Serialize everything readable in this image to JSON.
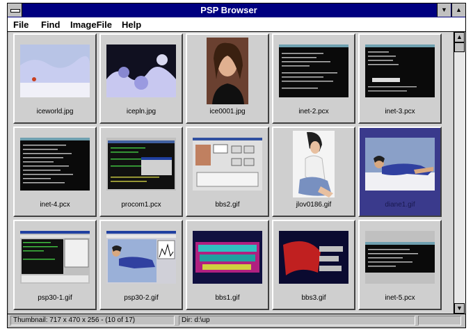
{
  "window": {
    "title": "PSP Browser"
  },
  "menu": [
    "File",
    "Find",
    "ImageFile",
    "Help"
  ],
  "thumbnails": [
    "iceworld.jpg",
    "icepln.jpg",
    "ice0001.jpg",
    "inet-2.pcx",
    "inet-3.pcx",
    "inet-4.pcx",
    "procom1.pcx",
    "bbs2.gif",
    "jlov0186.gif",
    "diane1.gif",
    "psp30-1.gif",
    "psp30-2.gif",
    "bbs1.gif",
    "bbs3.gif",
    "inet-5.pcx"
  ],
  "selected_thumbnail": "diane1.gif",
  "status": {
    "thumbnail_info": "Thumbnail: 717 x 470 x 256 - (10 of 17)",
    "dir": "Dir: d:\\up"
  }
}
